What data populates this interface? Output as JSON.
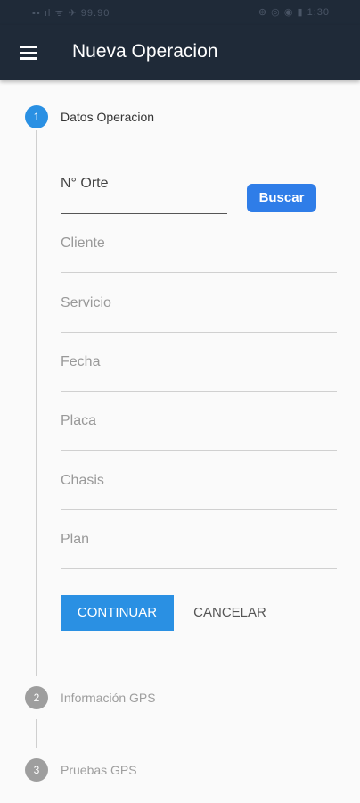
{
  "status_bar": {
    "left": "▪▪ ıl ᯤ ✈ 99.90",
    "right": "⊛ ◎ ◉ ▮ 1:30"
  },
  "app_bar": {
    "title": "Nueva Operacion",
    "menu_icon": "hamburger-menu-icon"
  },
  "steps": [
    {
      "number": "1",
      "label": "Datos Operacion",
      "state": "active"
    },
    {
      "number": "2",
      "label": "Información GPS",
      "state": "inactive"
    },
    {
      "number": "3",
      "label": "Pruebas GPS",
      "state": "inactive"
    }
  ],
  "form": {
    "orte_label": "N° Orte",
    "buscar_label": "Buscar",
    "fields": [
      "Cliente",
      "Servicio",
      "Fecha",
      "Placa",
      "Chasis",
      "Plan"
    ]
  },
  "actions": {
    "continuar": "CONTINUAR",
    "cancelar": "CANCELAR"
  },
  "colors": {
    "appbar": "#1f2a38",
    "accent": "#2a90e3",
    "buscar": "#2f7de8",
    "inactive": "#9e9e9e"
  }
}
